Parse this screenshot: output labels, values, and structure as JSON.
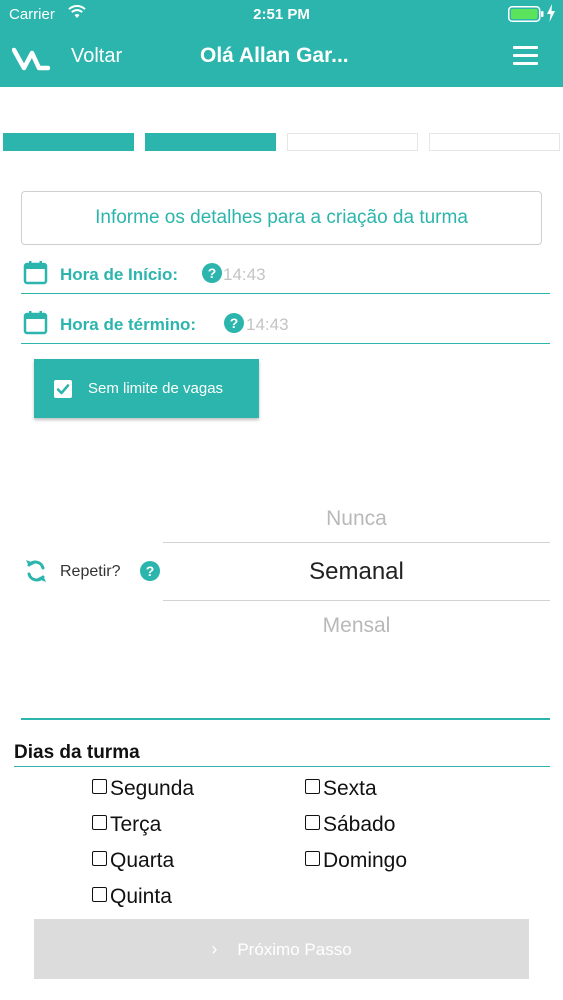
{
  "status_bar": {
    "carrier": "Carrier",
    "time": "2:51 PM"
  },
  "nav": {
    "back_label": "Voltar",
    "title": "Olá Allan Gar..."
  },
  "steps": {
    "total": 4,
    "completed": 2
  },
  "info_text": "Informe os detalhes para a criação da turma",
  "start_time": {
    "label": "Hora de Início:",
    "help": "?",
    "value": "14:43"
  },
  "end_time": {
    "label": "Hora de término:",
    "help": "?",
    "value": "14:43"
  },
  "no_limit": {
    "label": "Sem limite de vagas",
    "checked": true
  },
  "repeat": {
    "label": "Repetir?",
    "help": "?",
    "options": [
      "Nunca",
      "Semanal",
      "Mensal"
    ],
    "selected": "Semanal"
  },
  "days": {
    "title": "Dias da turma",
    "items": [
      "Segunda",
      "Terça",
      "Quarta",
      "Quinta",
      "Sexta",
      "Sábado",
      "Domingo"
    ]
  },
  "next_button": {
    "label": "Próximo Passo"
  },
  "colors": {
    "accent": "#2bb5ac",
    "disabled": "#dcdcdc",
    "placeholder": "#c4c4c4"
  }
}
